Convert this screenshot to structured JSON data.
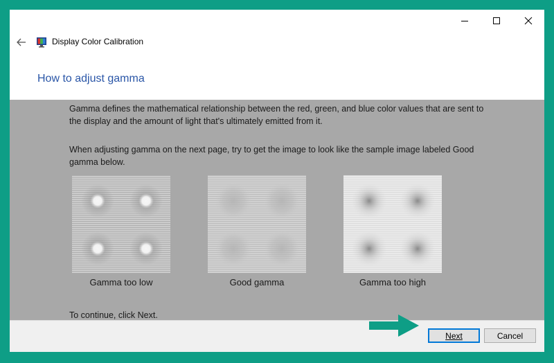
{
  "window": {
    "title": "Display Color Calibration",
    "controls": [
      "minimize",
      "maximize",
      "close"
    ]
  },
  "page": {
    "heading": "How to adjust gamma",
    "paragraph1": "Gamma defines the mathematical relationship between the red, green, and blue color values that are sent to the display and the amount of light that's ultimately emitted from it.",
    "paragraph2": "When adjusting gamma on the next page, try to get the image to look like the sample image labeled Good gamma below.",
    "samples": [
      {
        "label": "Gamma too low",
        "kind": "low"
      },
      {
        "label": "Good gamma",
        "kind": "good"
      },
      {
        "label": "Gamma too high",
        "kind": "high"
      }
    ],
    "continue_text": "To continue, click Next."
  },
  "footer": {
    "next_label": "Next",
    "cancel_label": "Cancel"
  },
  "colors": {
    "border": "#0e9e86",
    "heading": "#2a56a7",
    "content_bg": "#a8a8a8",
    "arrow": "#0e9e86"
  }
}
